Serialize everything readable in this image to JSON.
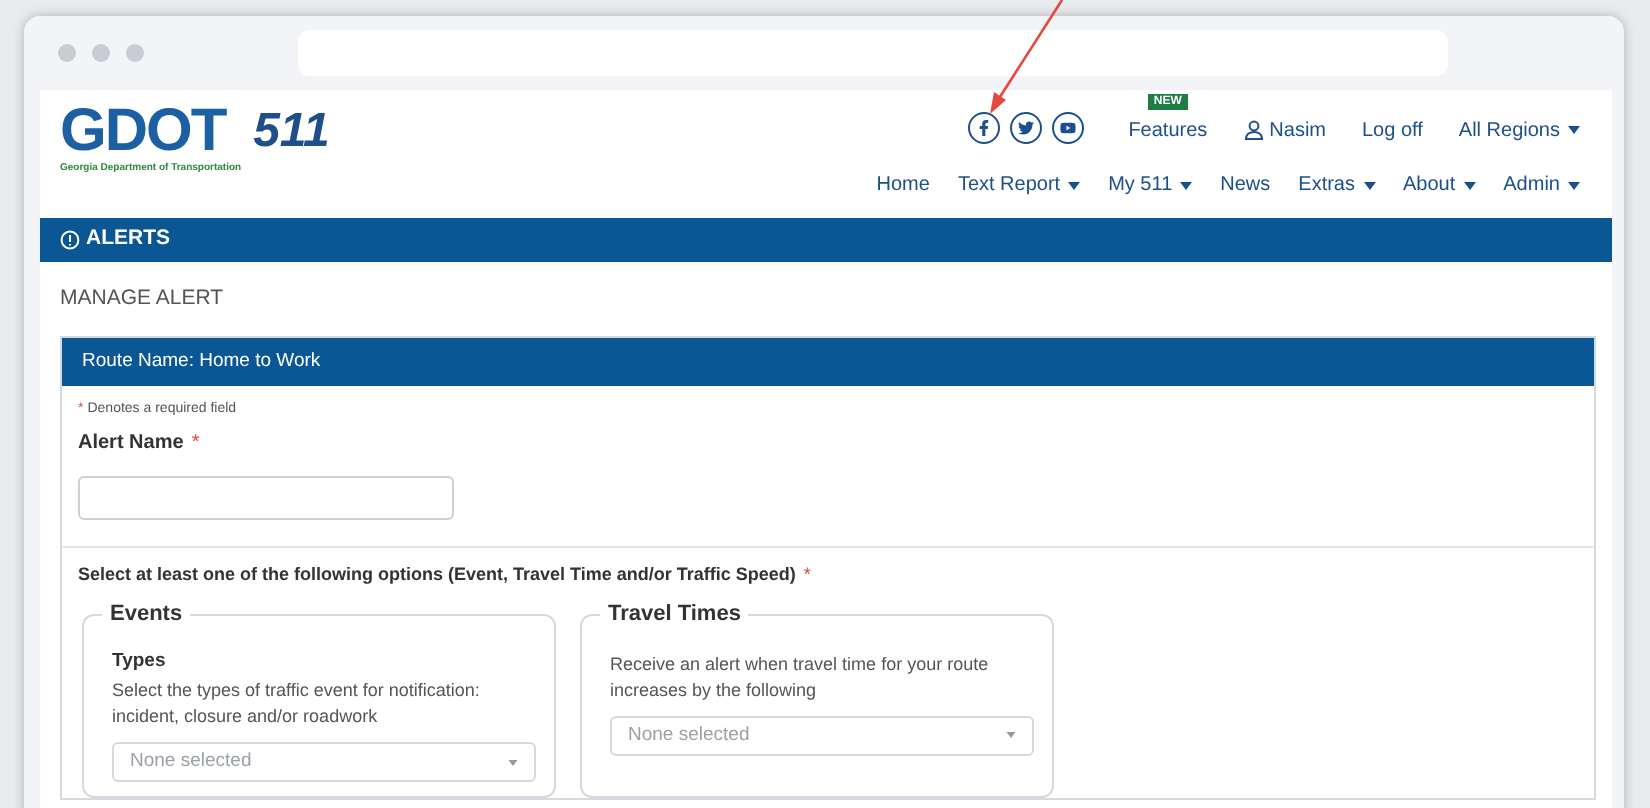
{
  "logo": {
    "name": "GDOT",
    "subtitle": "Georgia Department of Transportation",
    "badge": "511"
  },
  "top_links": [
    {
      "kind": "link",
      "label": "Features",
      "badge": "NEW"
    },
    {
      "kind": "user",
      "label": "Nasim"
    },
    {
      "kind": "link",
      "label": "Log off"
    },
    {
      "kind": "dropdown",
      "label": "All Regions"
    }
  ],
  "nav": [
    {
      "label": "Home",
      "dropdown": false
    },
    {
      "label": "Text Report",
      "dropdown": true
    },
    {
      "label": "My 511",
      "dropdown": true
    },
    {
      "label": "News",
      "dropdown": false
    },
    {
      "label": "Extras",
      "dropdown": true
    },
    {
      "label": "About",
      "dropdown": true
    },
    {
      "label": "Admin",
      "dropdown": true
    }
  ],
  "section_bar": {
    "title": "ALERTS"
  },
  "page_title": "MANAGE ALERT",
  "card": {
    "header": "Route Name: Home to Work",
    "required_mark": "*",
    "required_note": "Denotes a required field",
    "alert_name": {
      "label": "Alert Name",
      "required": true
    },
    "options_prompt": {
      "text": "Select at least one of the following options (Event, Travel Time and/or Traffic Speed)",
      "required": true
    },
    "fieldsets": [
      {
        "legend": "Events",
        "subtitle": "Types",
        "description": "Select the types of traffic event for notification: incident, closure and/or roadwork",
        "select": {
          "placeholder": "None selected"
        }
      },
      {
        "legend": "Travel Times",
        "description": "Receive an alert when travel time for your route increases by the following",
        "select": {
          "placeholder": "None selected"
        }
      }
    ]
  }
}
